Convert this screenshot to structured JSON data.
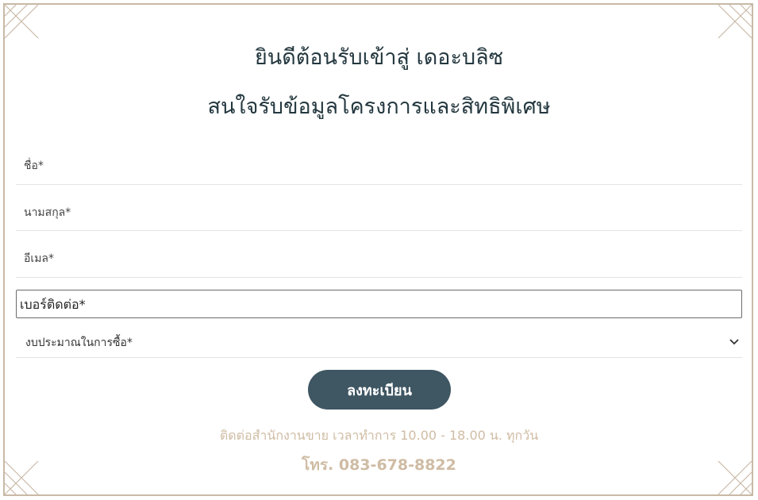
{
  "header": {
    "title_line1": "ยินดีต้อนรับเข้าสู่ เดอะบลิซ",
    "title_line2": "สนใจรับข้อมูลโครงการและสิทธิพิเศษ"
  },
  "form": {
    "first_name": {
      "placeholder": "ชื่อ*",
      "value": ""
    },
    "last_name": {
      "placeholder": "นามสกุล*",
      "value": ""
    },
    "email": {
      "placeholder": "อีเมล*",
      "value": ""
    },
    "phone": {
      "placeholder": "เบอร์ติดต่อ*",
      "value": ""
    },
    "budget": {
      "selected": "งบประมาณในการซื้อ*",
      "icon": "chevron-down-icon"
    },
    "submit_label": "ลงทะเบียน"
  },
  "footer": {
    "contact_hours": "ติดต่อสำนักงานขาย เวลาทำการ 10.00 - 18.00 น. ทุกวัน",
    "phone": "โทร. 083-678-8822"
  },
  "colors": {
    "title": "#24383f",
    "button": "#3f5663",
    "accent_text": "#cfbca4",
    "frame": "#c8b9a6"
  }
}
